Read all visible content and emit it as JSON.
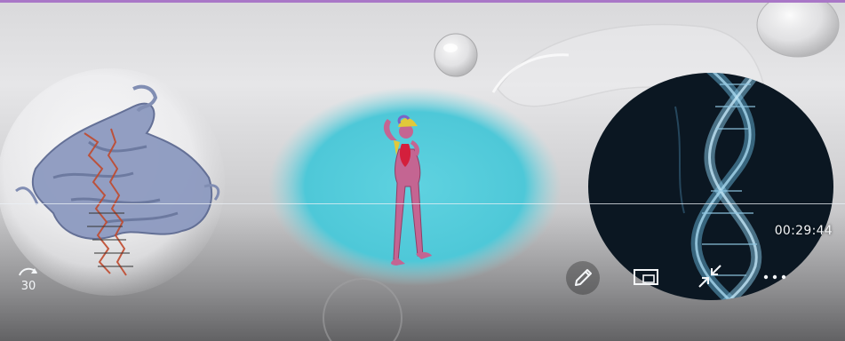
{
  "player": {
    "elapsed_time": "00:29:44",
    "skip_back_seconds": "30",
    "colors": {
      "frame_border": "#a977c7",
      "control_white": "#f4f6f8"
    },
    "controls": [
      {
        "name": "skip-back-30-button",
        "icon": "rewind-30-icon"
      },
      {
        "name": "pen-button",
        "icon": "pencil-icon"
      },
      {
        "name": "mini-view-button",
        "icon": "picture-in-picture-icon"
      },
      {
        "name": "exit-fullscreen-button",
        "icon": "collapse-arrows-icon"
      },
      {
        "name": "more-options-button",
        "icon": "ellipsis-icon"
      }
    ]
  }
}
